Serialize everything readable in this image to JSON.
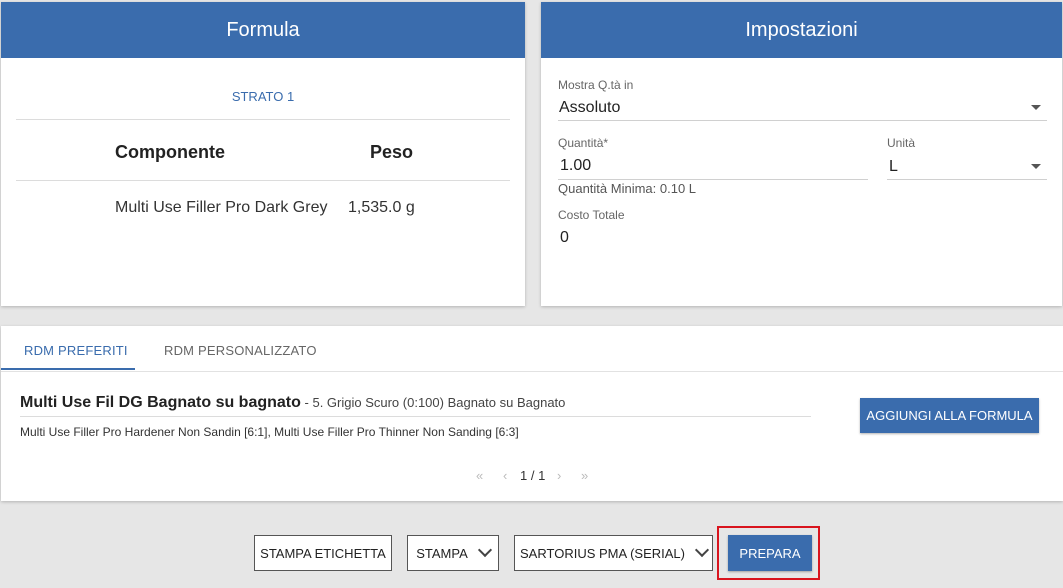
{
  "formula": {
    "header": "Formula",
    "layer": "STRATO 1",
    "columns": {
      "component": "Componente",
      "weight": "Peso"
    },
    "rows": [
      {
        "component": "Multi Use Filler Pro Dark Grey",
        "weight": "1,535.0 g"
      }
    ]
  },
  "settings": {
    "header": "Impostazioni",
    "show_qty_label": "Mostra Q.tà in",
    "show_qty_value": "Assoluto",
    "quantity_label": "Quantità*",
    "quantity_value": "1.00",
    "unit_label": "Unità",
    "unit_value": "L",
    "min_quantity": "Quantità Minima: 0.10 L",
    "total_cost_label": "Costo Totale",
    "total_cost_value": "0"
  },
  "rdm": {
    "tabs": [
      "RDM PREFERITI",
      "RDM PERSONALIZZATO"
    ],
    "active_tab": 0,
    "item": {
      "title": "Multi Use Fil DG Bagnato su bagnato",
      "desc": " - 5. Grigio Scuro (0:100) Bagnato su Bagnato",
      "sub": "Multi Use Filler Pro Hardener Non Sandin [6:1], Multi Use Filler Pro Thinner Non Sanding [6:3]"
    },
    "add_button": "AGGIUNGI ALLA FORMULA",
    "pager": {
      "first": "«",
      "prev": "‹",
      "text": "1 / 1",
      "next": "›",
      "last": "»"
    }
  },
  "footer": {
    "print_label": "STAMPA ETICHETTA",
    "print": "STAMPA",
    "scale": "SARTORIUS PMA (SERIAL)",
    "prepare": "PREPARA"
  },
  "colors": {
    "primary": "#3a6cad",
    "highlight": "#d9141e"
  }
}
